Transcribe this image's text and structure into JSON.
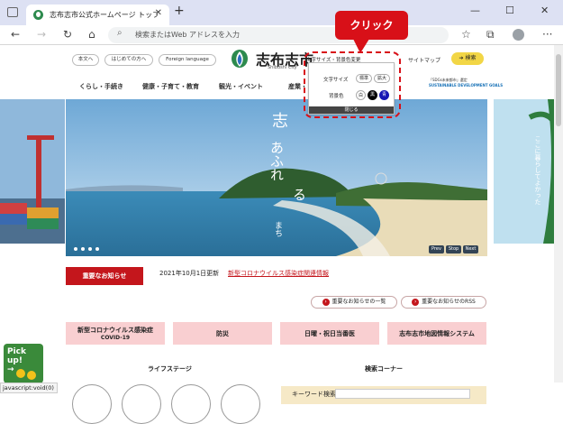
{
  "browser": {
    "tab_title": "志布志市公式ホームページ トップペ",
    "tab_close": "✕",
    "new_tab": "+",
    "win_min": "—",
    "win_max": "☐",
    "win_close": "✕",
    "address_placeholder": "検索またはWeb アドレスを入力",
    "status_text": "javascript:void(0)"
  },
  "header": {
    "btn_text_only": "本文へ",
    "btn_first_time": "はじめての方へ",
    "btn_foreign": "Foreign language",
    "site_name": "志布志市",
    "site_en": "Shibushi City",
    "text_size_link": "文字サイズ・背景色変更",
    "sitemap": "サイトマップ",
    "search": "検索",
    "sdgs_top": "「SDGs未来都市」選定",
    "sdgs_main": "SUSTAINABLE DEVELOPMENT GOALS"
  },
  "popup": {
    "size_label": "文字サイズ",
    "size_standard": "標準",
    "size_large": "拡大",
    "bg_label": "背景色",
    "bg_white": "白",
    "bg_black": "黒",
    "bg_blue": "青",
    "close": "閉じる"
  },
  "annotation": {
    "callout": "クリック"
  },
  "nav": {
    "items": [
      "くらし・手続き",
      "健康・子育て・教育",
      "観光・イベント",
      "産業・ビ"
    ]
  },
  "hero": {
    "vertical_text_1": "志",
    "vertical_text_2": "あふれ",
    "vertical_text_3": "る",
    "vertical_text_4": "まち",
    "right_text": "ここに暮らしてよかった",
    "prev": "Prev",
    "stop": "Stop",
    "next": "Next"
  },
  "notice": {
    "important": "重要なお知らせ",
    "date": "2021年10月1日更新",
    "link": "新型コロナウイルス感染症関連情報",
    "list_link": "重要なお知らせの一覧",
    "rss_link": "重要なお知らせのRSS"
  },
  "quick_links": [
    {
      "line1": "新型コロナウイルス感染症",
      "line2": "COVID-19"
    },
    {
      "line1": "防災",
      "line2": ""
    },
    {
      "line1": "日曜・祝日当番医",
      "line2": ""
    },
    {
      "line1": "志布志市地図情報システム",
      "line2": ""
    }
  ],
  "sections": {
    "life_stage": "ライフステージ",
    "search_corner": "検索コーナー",
    "keyword": "キーワード検索"
  },
  "pickup": {
    "label": "Pick up!",
    "arrow": "→"
  },
  "colors": {
    "accent_red": "#c4161c",
    "pink": "#f9cfd1",
    "search_yellow": "#f2d646",
    "annotation": "#d81018"
  }
}
